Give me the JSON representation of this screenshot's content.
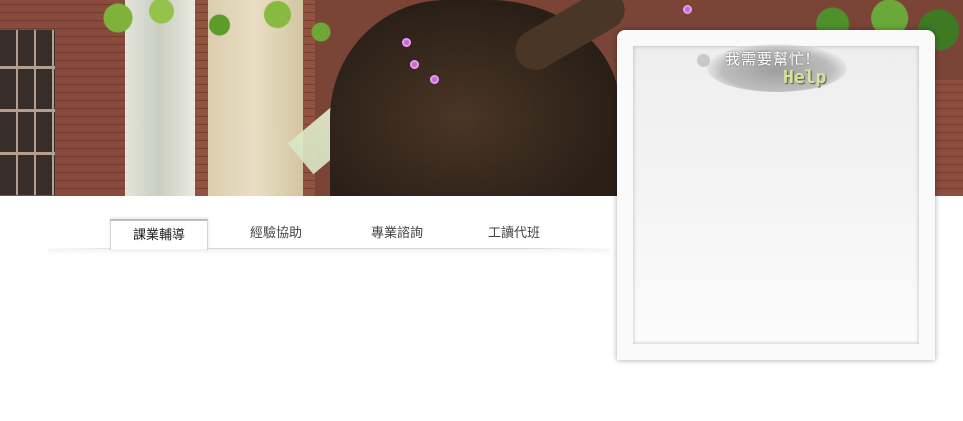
{
  "banner": {
    "image": "campus-tree-photo"
  },
  "help": {
    "title_zh": "我需要幫忙!",
    "title_en": "Help"
  },
  "tabs": [
    {
      "label": "課業輔導",
      "active": true
    },
    {
      "label": "經驗協助",
      "active": false
    },
    {
      "label": "專業諮詢",
      "active": false
    },
    {
      "label": "工讀代班",
      "active": false
    }
  ]
}
